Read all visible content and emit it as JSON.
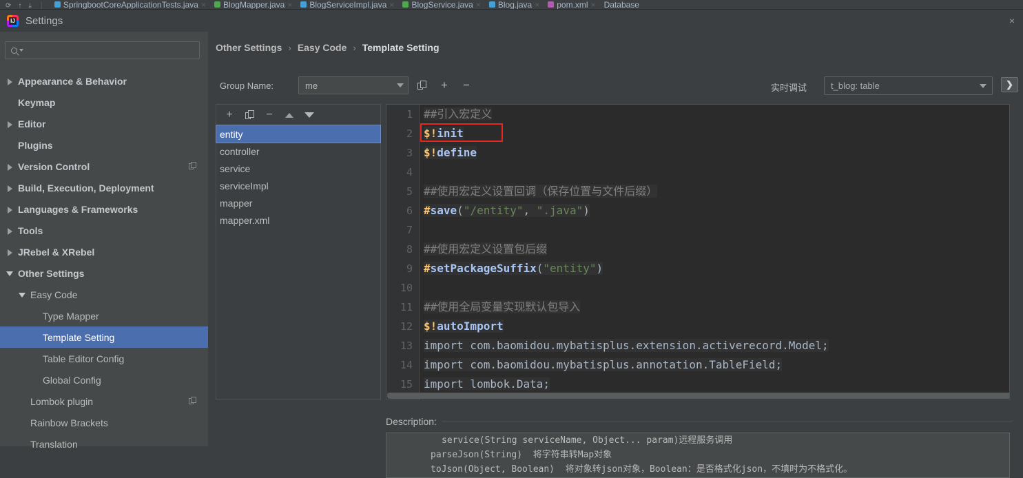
{
  "ide_tabs": [
    {
      "label": "SpringbootCoreApplicationTests.java",
      "icon_color": "#46a0d4"
    },
    {
      "label": "BlogMapper.java",
      "icon_color": "#4fa84f"
    },
    {
      "label": "BlogServiceImpl.java",
      "icon_color": "#46a0d4"
    },
    {
      "label": "BlogService.java",
      "icon_color": "#4fa84f"
    },
    {
      "label": "Blog.java",
      "icon_color": "#46a0d4"
    },
    {
      "label": "pom.xml",
      "icon_color": "#b05ab0"
    },
    {
      "label": "Database",
      "icon_color": "#6b7175"
    }
  ],
  "dialog": {
    "title": "Settings",
    "close_label": "×",
    "logo_letters": "IJ"
  },
  "search": {
    "value": "",
    "placeholder": ""
  },
  "sidebar": {
    "items": [
      {
        "label": "Appearance & Behavior",
        "indent": 0,
        "twisty": "right",
        "bold": true,
        "badge": false,
        "selected": false
      },
      {
        "label": "Keymap",
        "indent": 0,
        "twisty": "none",
        "bold": true,
        "badge": false,
        "selected": false
      },
      {
        "label": "Editor",
        "indent": 0,
        "twisty": "right",
        "bold": true,
        "badge": false,
        "selected": false
      },
      {
        "label": "Plugins",
        "indent": 0,
        "twisty": "none",
        "bold": true,
        "badge": false,
        "selected": false
      },
      {
        "label": "Version Control",
        "indent": 0,
        "twisty": "right",
        "bold": true,
        "badge": true,
        "selected": false
      },
      {
        "label": "Build, Execution, Deployment",
        "indent": 0,
        "twisty": "right",
        "bold": true,
        "badge": false,
        "selected": false
      },
      {
        "label": "Languages & Frameworks",
        "indent": 0,
        "twisty": "right",
        "bold": true,
        "badge": false,
        "selected": false
      },
      {
        "label": "Tools",
        "indent": 0,
        "twisty": "right",
        "bold": true,
        "badge": false,
        "selected": false
      },
      {
        "label": "JRebel & XRebel",
        "indent": 0,
        "twisty": "right",
        "bold": true,
        "badge": false,
        "selected": false
      },
      {
        "label": "Other Settings",
        "indent": 0,
        "twisty": "down",
        "bold": true,
        "badge": false,
        "selected": false
      },
      {
        "label": "Easy Code",
        "indent": 1,
        "twisty": "down",
        "bold": false,
        "badge": false,
        "selected": false
      },
      {
        "label": "Type Mapper",
        "indent": 2,
        "twisty": "none",
        "bold": false,
        "badge": false,
        "selected": false
      },
      {
        "label": "Template Setting",
        "indent": 2,
        "twisty": "none",
        "bold": false,
        "badge": false,
        "selected": true
      },
      {
        "label": "Table Editor Config",
        "indent": 2,
        "twisty": "none",
        "bold": false,
        "badge": false,
        "selected": false
      },
      {
        "label": "Global Config",
        "indent": 2,
        "twisty": "none",
        "bold": false,
        "badge": false,
        "selected": false
      },
      {
        "label": "Lombok plugin",
        "indent": 1,
        "twisty": "none",
        "bold": false,
        "badge": true,
        "selected": false
      },
      {
        "label": "Rainbow Brackets",
        "indent": 1,
        "twisty": "none",
        "bold": false,
        "badge": false,
        "selected": false
      },
      {
        "label": "Translation",
        "indent": 1,
        "twisty": "none",
        "bold": false,
        "badge": false,
        "selected": false
      }
    ]
  },
  "breadcrumb": {
    "items": [
      "Other Settings",
      "Easy Code",
      "Template Setting"
    ],
    "separator": "›"
  },
  "toolbar": {
    "group_label": "Group Name:",
    "group_value": "me",
    "copy_label": "copy-icon",
    "add_label": "+",
    "remove_label": "−",
    "debug_label": "实时调试",
    "debug_value": "t_blog: table",
    "debug_go_label": "❯"
  },
  "template_list": {
    "toolbar": {
      "add": "+",
      "copy": "copy-icon",
      "remove": "−",
      "move_up": "move-up-icon",
      "move_down": "move-down-icon"
    },
    "items": [
      {
        "label": "entity",
        "selected": true
      },
      {
        "label": "controller",
        "selected": false
      },
      {
        "label": "service",
        "selected": false
      },
      {
        "label": "serviceImpl",
        "selected": false
      },
      {
        "label": "mapper",
        "selected": false
      },
      {
        "label": "mapper.xml",
        "selected": false
      }
    ]
  },
  "editor": {
    "highlighted_line": 2,
    "lines": [
      {
        "n": 1,
        "tokens": [
          {
            "t": "##引入宏定义",
            "c": "cm"
          }
        ]
      },
      {
        "n": 2,
        "tokens": [
          {
            "t": "$!",
            "c": "dir"
          },
          {
            "t": "init",
            "c": "mac"
          }
        ]
      },
      {
        "n": 3,
        "tokens": [
          {
            "t": "$!",
            "c": "dir"
          },
          {
            "t": "define",
            "c": "mac"
          }
        ]
      },
      {
        "n": 4,
        "tokens": []
      },
      {
        "n": 5,
        "tokens": [
          {
            "t": "##使用宏定义设置回调（保存位置与文件后缀）",
            "c": "cm"
          }
        ]
      },
      {
        "n": 6,
        "tokens": [
          {
            "t": "#",
            "c": "dir"
          },
          {
            "t": "save",
            "c": "mac"
          },
          {
            "t": "(",
            "c": "pn"
          },
          {
            "t": "\"/entity\"",
            "c": "str"
          },
          {
            "t": ", ",
            "c": "pn"
          },
          {
            "t": "\".java\"",
            "c": "str"
          },
          {
            "t": ")",
            "c": "pn"
          }
        ]
      },
      {
        "n": 7,
        "tokens": []
      },
      {
        "n": 8,
        "tokens": [
          {
            "t": "##使用宏定义设置包后缀",
            "c": "cm"
          }
        ]
      },
      {
        "n": 9,
        "tokens": [
          {
            "t": "#",
            "c": "dir"
          },
          {
            "t": "setPackageSuffix",
            "c": "mac"
          },
          {
            "t": "(",
            "c": "pn"
          },
          {
            "t": "\"entity\"",
            "c": "str"
          },
          {
            "t": ")",
            "c": "pn"
          }
        ]
      },
      {
        "n": 10,
        "tokens": []
      },
      {
        "n": 11,
        "tokens": [
          {
            "t": "##使用全局变量实现默认包导入",
            "c": "cm"
          }
        ]
      },
      {
        "n": 12,
        "tokens": [
          {
            "t": "$!",
            "c": "dir"
          },
          {
            "t": "autoImport",
            "c": "mac"
          }
        ]
      },
      {
        "n": 13,
        "tokens": [
          {
            "t": "import com.baomidou.mybatisplus.extension.activerecord.Model;",
            "c": "pn"
          }
        ]
      },
      {
        "n": 14,
        "tokens": [
          {
            "t": "import com.baomidou.mybatisplus.annotation.TableField;",
            "c": "pn"
          }
        ]
      },
      {
        "n": 15,
        "tokens": [
          {
            "t": "import lombok.Data;",
            "c": "pn"
          }
        ]
      }
    ]
  },
  "description": {
    "label": "Description:",
    "lines": [
      "service(String serviceName, Object... param)远程服务调用",
      "parseJson(String)  将字符串转Map对象",
      "toJson(Object, Boolean)  将对象转json对象，Boolean：是否格式化json，不填时为不格式化。"
    ]
  },
  "colors": {
    "accent_selection": "#4b6eaf",
    "highlight_box": "#e8251f",
    "panel_bg": "#3c3f41",
    "sidebar_bg": "#45494a",
    "editor_bg": "#2b2b2b"
  }
}
